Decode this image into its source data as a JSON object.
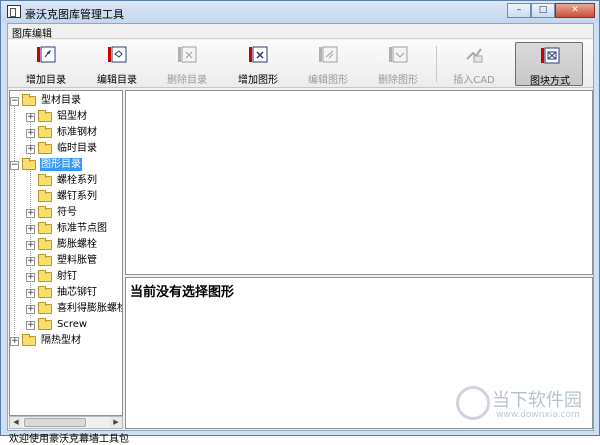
{
  "window": {
    "title": "豪沃克图库管理工具"
  },
  "menu": {
    "items": [
      "图库编辑"
    ]
  },
  "toolbar": {
    "buttons": [
      {
        "label": "增加目录",
        "icon": "add-folder-icon",
        "enabled": true
      },
      {
        "label": "编辑目录",
        "icon": "edit-folder-icon",
        "enabled": true
      },
      {
        "label": "删除目录",
        "icon": "delete-folder-icon",
        "enabled": false
      },
      {
        "label": "增加图形",
        "icon": "add-shape-icon",
        "enabled": true
      },
      {
        "label": "编辑图形",
        "icon": "edit-shape-icon",
        "enabled": false
      },
      {
        "label": "删除图形",
        "icon": "delete-shape-icon",
        "enabled": false
      },
      {
        "label": "插入CAD",
        "icon": "insert-cad-icon",
        "enabled": false
      },
      {
        "label": "图块方式",
        "icon": "block-mode-icon",
        "enabled": true,
        "pressed": true
      }
    ]
  },
  "tree": {
    "items": [
      {
        "label": "型材目录",
        "expanded": true
      },
      {
        "label": "铝型材",
        "expanded": false
      },
      {
        "label": "标准钢材",
        "expanded": false
      },
      {
        "label": "临时目录",
        "expanded": false
      },
      {
        "label": "图形目录",
        "expanded": true,
        "selected": true
      },
      {
        "label": "螺栓系列"
      },
      {
        "label": "螺钉系列"
      },
      {
        "label": "符号",
        "expanded": false
      },
      {
        "label": "标准节点图",
        "expanded": false
      },
      {
        "label": "膨胀螺栓",
        "expanded": false
      },
      {
        "label": "塑料胀管",
        "expanded": false
      },
      {
        "label": "射钉",
        "expanded": false
      },
      {
        "label": "抽芯铆钉",
        "expanded": false
      },
      {
        "label": "喜利得膨胀螺栓",
        "expanded": false
      },
      {
        "label": "Screw",
        "expanded": false
      },
      {
        "label": "隔热型材",
        "expanded": false
      }
    ]
  },
  "info": {
    "text": "当前没有选择图形"
  },
  "status": {
    "text": "欢迎使用豪沃克幕墙工具包"
  },
  "watermark": {
    "text_cn": "当下软件园",
    "url": "www.downxia.com"
  },
  "colors": {
    "selection": "#3399ff",
    "folder": "#f8de6c",
    "accent_red": "#cc0000"
  }
}
